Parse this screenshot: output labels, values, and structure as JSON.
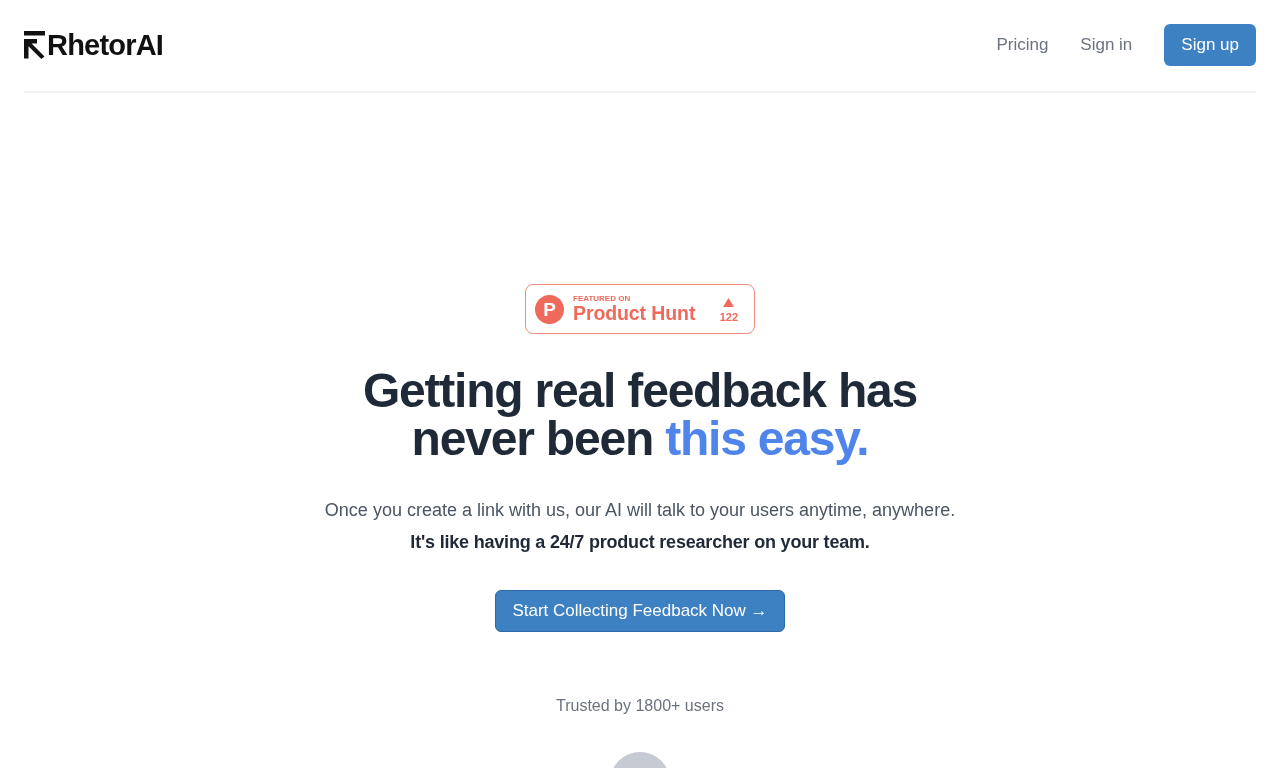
{
  "header": {
    "logo": {
      "text": "RhetorAI"
    },
    "nav": [
      {
        "label": "Pricing",
        "kind": "link"
      },
      {
        "label": "Sign in",
        "kind": "link"
      },
      {
        "label": "Sign up",
        "kind": "button"
      }
    ]
  },
  "hero": {
    "badge": {
      "logo_letter": "P",
      "eyebrow": "FEATURED ON",
      "name": "Product Hunt",
      "upvotes": "122"
    },
    "heading": {
      "text": "Getting real feedback has never been ",
      "highlight": "this easy."
    },
    "subtitle": "Once you create a link with us, our AI will talk to your users anytime, anywhere.",
    "tagline": "It's like having a 24/7 product researcher on your team.",
    "cta": {
      "label": "Start Collecting Feedback Now →"
    },
    "social_proof": {
      "text": "Trusted by 1800+ users"
    }
  }
}
